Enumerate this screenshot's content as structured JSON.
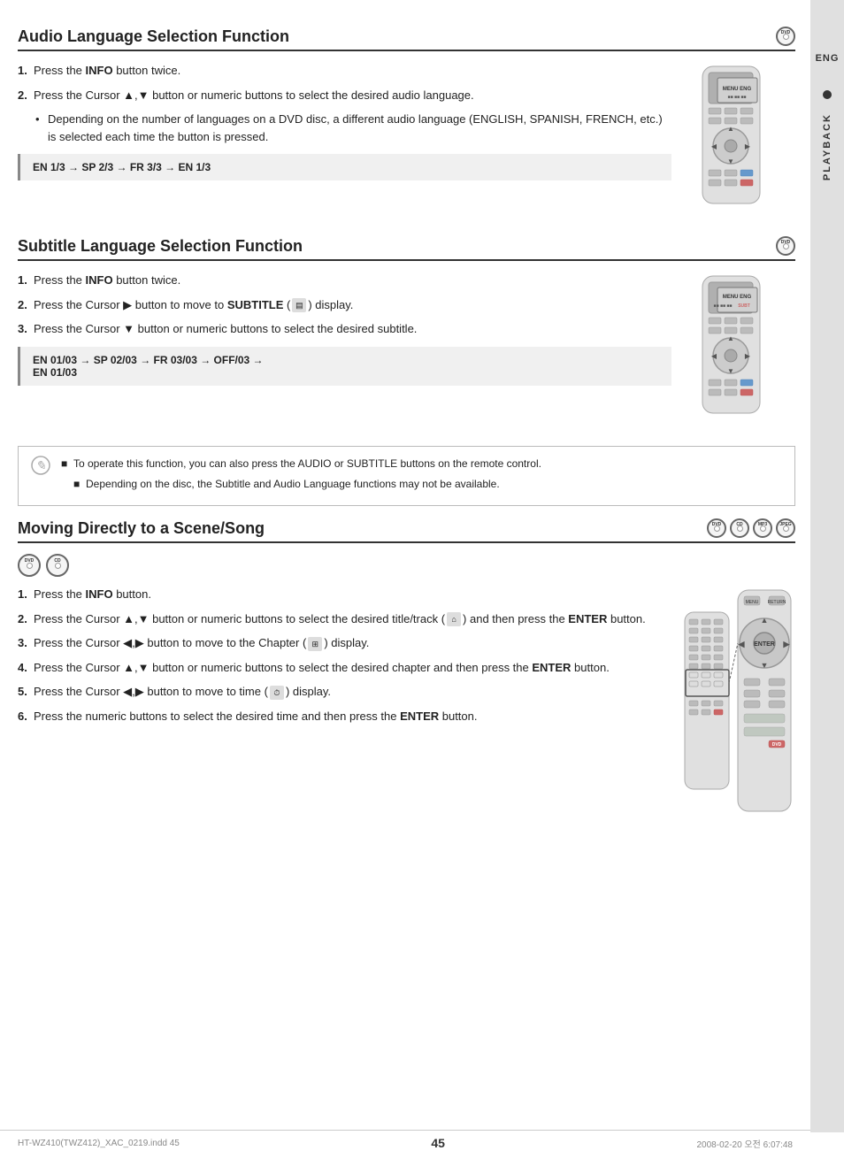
{
  "page": {
    "number": "45",
    "filename": "HT-WZ410(TWZ412)_XAC_0219.indd   45",
    "date": "2008-02-20   오전 6:07:48"
  },
  "sidebar": {
    "lang_label": "ENG",
    "section_label": "PLAYBACK"
  },
  "section1": {
    "title": "Audio Language Selection Function",
    "disc_type": "DVD",
    "steps": [
      {
        "num": "1.",
        "text": "Press the ",
        "bold_text": "INFO",
        "text2": " button twice."
      },
      {
        "num": "2.",
        "text": "Press the Cursor ▲,▼ button or numeric buttons to select the desired audio language."
      }
    ],
    "bullet": "Depending on the number of languages on a DVD disc, a different audio language (ENGLISH, SPANISH, FRENCH, etc.) is selected each time the button is pressed.",
    "flow_label": "EN 1/3 → SP 2/3 → FR 3/3 → EN 1/3"
  },
  "section2": {
    "title": "Subtitle Language Selection Function",
    "disc_type": "DVD",
    "steps": [
      {
        "num": "1.",
        "text": "Press the ",
        "bold_text": "INFO",
        "text2": " button twice."
      },
      {
        "num": "2.",
        "text": "Press the Cursor ▶ button to move to ",
        "bold_text": "SUBTITLE",
        "text2": " (  ) display."
      },
      {
        "num": "3.",
        "text": "Press the Cursor ▼ button or numeric buttons to select the desired subtitle."
      }
    ],
    "flow_label1": "EN 01/03 → SP 02/03 → FR 03/03 → OFF/03 →",
    "flow_label2": "EN 01/03"
  },
  "note": {
    "items": [
      "To operate this function, you can also press the AUDIO or SUBTITLE buttons on the remote control.",
      "Depending on the disc, the Subtitle and Audio Language functions may not be available."
    ]
  },
  "section3": {
    "title": "Moving Directly to a Scene/Song",
    "disc_types": [
      "DVD",
      "CD",
      "MP3",
      "JPEG"
    ],
    "sub_disc_types": [
      "DVD",
      "CD"
    ],
    "steps": [
      {
        "num": "1.",
        "text": "Press the ",
        "bold_text": "INFO",
        "text2": " button."
      },
      {
        "num": "2.",
        "text": "Press the Cursor ▲,▼ button or numeric buttons to select the desired title/track (  )  and then press the ",
        "bold_text": "ENTER",
        "text2": " button."
      },
      {
        "num": "3.",
        "text": "Press the Cursor ◀,▶ button to move to the Chapter (  ) display."
      },
      {
        "num": "4.",
        "text": "Press the Cursor ▲,▼ button or numeric buttons to select the desired chapter and then press the ",
        "bold_text": "ENTER",
        "text2": " button."
      },
      {
        "num": "5.",
        "text": "Press the Cursor ◀,▶ button to move to time (  ) display."
      },
      {
        "num": "6.",
        "text": "Press the numeric buttons to select the desired time and then press the ",
        "bold_text": "ENTER",
        "text2": " button."
      }
    ]
  }
}
